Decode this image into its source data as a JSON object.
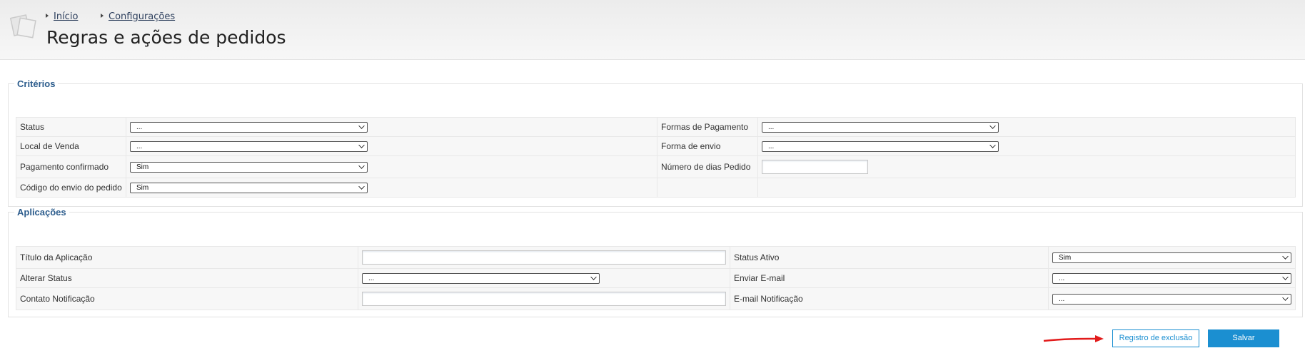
{
  "header": {
    "breadcrumb": [
      "Início",
      "Configurações"
    ],
    "title": "Regras e ações de pedidos"
  },
  "criteria": {
    "legend": "Critérios",
    "left_rows": [
      {
        "label": "Status",
        "value": "..."
      },
      {
        "label": "Local de Venda",
        "value": "..."
      },
      {
        "label": "Pagamento confirmado",
        "value": "Sim"
      },
      {
        "label": "Código do envio do pedido",
        "value": "Sim"
      }
    ],
    "right_rows": [
      {
        "label": "Formas de Pagamento",
        "value": "..."
      },
      {
        "label": "Forma de envio",
        "value": "..."
      },
      {
        "label": "Número de dias Pedido",
        "value": ""
      }
    ]
  },
  "applications": {
    "legend": "Aplicações",
    "left_rows": [
      {
        "label": "Título da Aplicação",
        "value": ""
      },
      {
        "label": "Alterar Status",
        "value": "..."
      },
      {
        "label": "Contato Notificação",
        "value": ""
      }
    ],
    "right_rows": [
      {
        "label": "Status Ativo",
        "value": "Sim"
      },
      {
        "label": "Enviar E-mail",
        "value": "..."
      },
      {
        "label": "E-mail Notificação",
        "value": "..."
      }
    ]
  },
  "actions": {
    "exclusion_log_label": "Registro de exclusão",
    "save_label": "Salvar"
  },
  "colors": {
    "accent": "#1b8fd1",
    "legend": "#2d5d8d",
    "annotation_arrow": "#e21b1b"
  },
  "icons": {
    "logo": "stacked-pages-icon",
    "breadcrumb_separator": "triangle-right-icon",
    "select_arrow": "chevron-down-icon",
    "annotation": "red-arrow-icon"
  }
}
